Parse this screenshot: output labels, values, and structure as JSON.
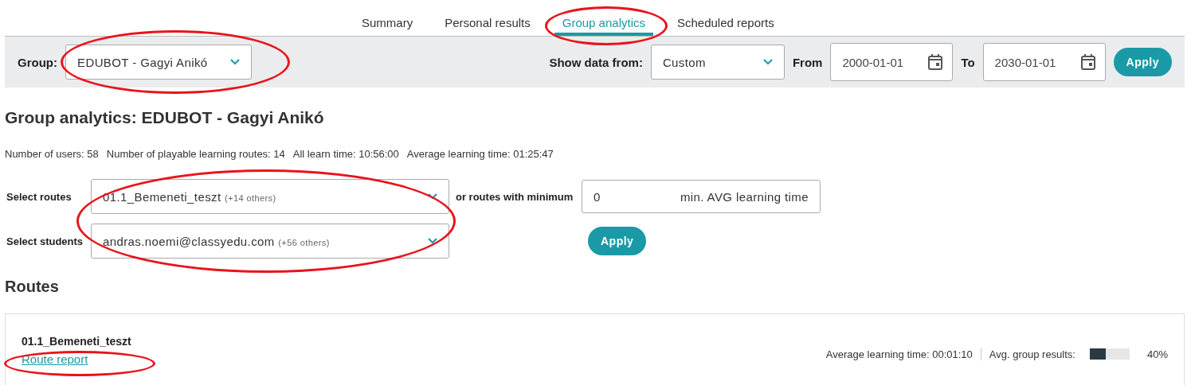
{
  "tabs": [
    {
      "label": "Summary",
      "selected": false,
      "circled": false
    },
    {
      "label": "Personal results",
      "selected": false,
      "circled": false
    },
    {
      "label": "Group analytics",
      "selected": true,
      "circled": true
    },
    {
      "label": "Scheduled reports",
      "selected": false,
      "circled": false
    }
  ],
  "filter_bar": {
    "group_label": "Group:",
    "group_value": "EDUBOT - Gagyi Anikó",
    "group_circled": true,
    "show_label": "Show data from:",
    "show_value": "Custom",
    "from_label": "From",
    "from_value": "2000-01-01",
    "to_label": "To",
    "to_value": "2030-01-01",
    "apply": "Apply"
  },
  "title": "Group analytics: EDUBOT - Gagyi Anikó",
  "stats": [
    "Number of users: 58",
    "Number of playable learning routes: 14",
    "All learn time: 10:56:00",
    "Average learning time: 01:25:47"
  ],
  "selectors": {
    "circled": true,
    "routes_label": "Select routes",
    "routes_value": "01.1_Bemeneti_teszt",
    "routes_more": "(+14 others)",
    "min_label": "or routes with minimum",
    "min_value": "0",
    "min_suffix": "min. AVG learning time",
    "students_label": "Select students",
    "students_value": "andras.noemi@classyedu.com",
    "students_more": "(+56 others)",
    "apply": "Apply"
  },
  "routes_heading": "Routes",
  "routes": [
    {
      "name": "01.1_Bemeneti_teszt",
      "link": "Route report",
      "link_circled": true,
      "avg_time": "Average learning time: 00:01:10",
      "results_label": "Avg. group results:",
      "level": 0.4,
      "percent": "40%"
    }
  ]
}
